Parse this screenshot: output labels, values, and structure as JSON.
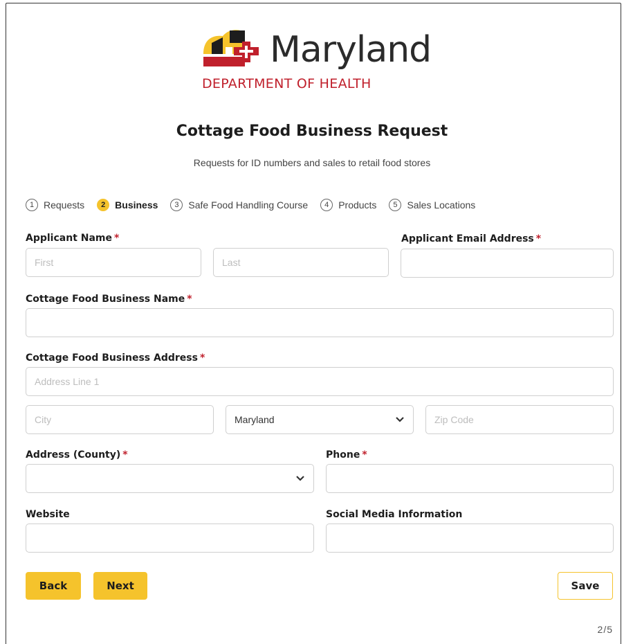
{
  "logo": {
    "wordmark": "Maryland",
    "department": "DEPARTMENT OF HEALTH"
  },
  "header": {
    "title": "Cottage Food Business Request",
    "subtitle": "Requests for ID numbers and sales to retail food stores"
  },
  "steps": [
    {
      "num": "1",
      "label": "Requests",
      "active": false
    },
    {
      "num": "2",
      "label": "Business",
      "active": true
    },
    {
      "num": "3",
      "label": "Safe Food Handling Course",
      "active": false
    },
    {
      "num": "4",
      "label": "Products",
      "active": false
    },
    {
      "num": "5",
      "label": "Sales Locations",
      "active": false
    }
  ],
  "form": {
    "required_mark": "*",
    "applicant_name": {
      "label": "Applicant Name",
      "first_placeholder": "First",
      "last_placeholder": "Last",
      "first_value": "",
      "last_value": ""
    },
    "applicant_email": {
      "label": "Applicant Email Address",
      "value": ""
    },
    "business_name": {
      "label": "Cottage Food Business Name",
      "value": ""
    },
    "business_address": {
      "label": "Cottage Food Business Address",
      "line1_placeholder": "Address Line 1",
      "city_placeholder": "City",
      "state_value": "Maryland",
      "zip_placeholder": "Zip Code"
    },
    "county": {
      "label": "Address (County)",
      "value": ""
    },
    "phone": {
      "label": "Phone",
      "value": ""
    },
    "website": {
      "label": "Website",
      "value": ""
    },
    "social": {
      "label": "Social Media Information",
      "value": ""
    }
  },
  "buttons": {
    "back": "Back",
    "next": "Next",
    "save": "Save"
  },
  "pager": "2/5",
  "colors": {
    "accent": "#f5c32c",
    "required": "#c0202c",
    "brand_red": "#c0202c"
  },
  "icons": {
    "select_chevron": "chevron-down-icon"
  }
}
